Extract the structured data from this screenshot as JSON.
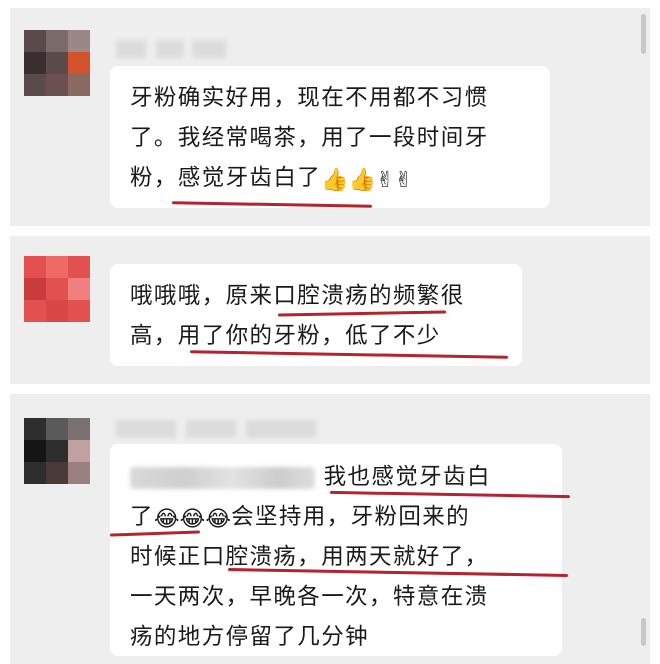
{
  "messages": [
    {
      "lines": [
        "牙粉确实好用，现在不用都不习惯",
        "了。我经常喝茶，用了一段时间牙",
        "粉，感觉牙齿白了"
      ],
      "emojis": [
        "👍",
        "👍",
        "✌",
        "✌"
      ]
    },
    {
      "lines": [
        "哦哦哦，原来口腔溃疡的频繁很",
        "高，用了你的牙粉，低了不少"
      ]
    },
    {
      "line1_tail": "我也感觉牙齿白",
      "line2_head": "了",
      "line2_tail": "会坚持用，牙粉回来的",
      "lines": [
        "时候正口腔溃疡，用两天就好了，",
        "一天两次，早晚各一次，特意在溃",
        "疡的地方停留了几分钟"
      ],
      "emojis": [
        "😂",
        "😂",
        "😂"
      ]
    }
  ],
  "colors": {
    "panel": "#eeeeee",
    "bubble": "#ffffff",
    "underline": "#b3242f"
  }
}
